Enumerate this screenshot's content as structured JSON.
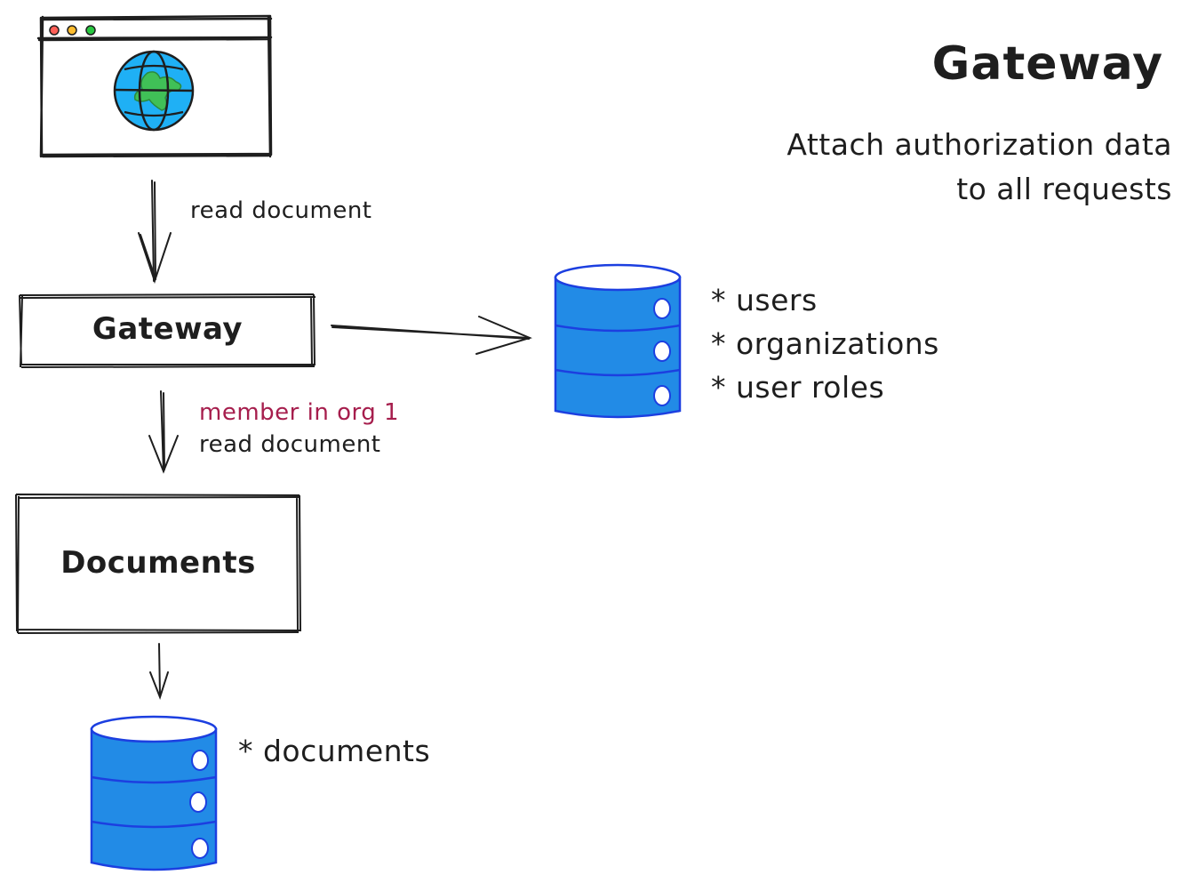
{
  "title": "Gateway",
  "subtitle": [
    "Attach authorization data",
    "to all requests"
  ],
  "browser": {
    "icon": "globe-icon",
    "window_dots": [
      "#ff5f57",
      "#febc2e",
      "#28c840"
    ]
  },
  "arrows": {
    "browser_to_gateway_label": "read document",
    "gateway_to_documents_label_1": "member in org 1",
    "gateway_to_documents_label_2": "read document"
  },
  "nodes": {
    "gateway": "Gateway",
    "documents": "Documents"
  },
  "auth_db": {
    "icon": "database-icon",
    "items": [
      "* users",
      "* organizations",
      "* user roles"
    ]
  },
  "docs_db": {
    "icon": "database-icon",
    "items": [
      "* documents"
    ]
  },
  "colors": {
    "db_fill": "#228be6",
    "db_stroke": "#1c3fe0",
    "accent_text": "#a61e4d",
    "globe_water": "#1fb0f5",
    "globe_land": "#40c057"
  }
}
